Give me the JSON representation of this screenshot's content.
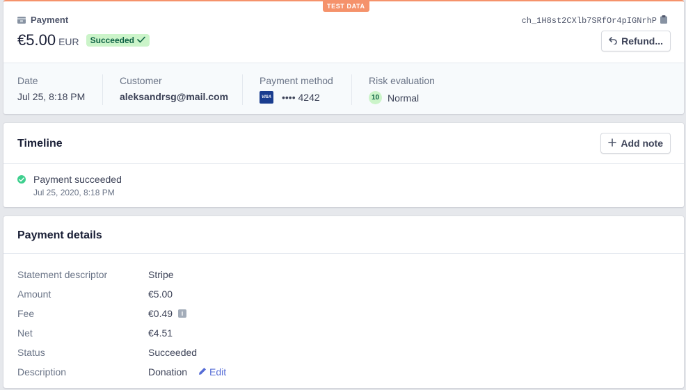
{
  "header": {
    "test_badge": "TEST DATA",
    "object_label": "Payment",
    "charge_id": "ch_1H8st2CXlb7SRfOr4pIGNrhP",
    "amount": "€5.00",
    "currency": "EUR",
    "status": "Succeeded",
    "refund_label": "Refund..."
  },
  "summary": {
    "date_label": "Date",
    "date_value": "Jul 25, 8:18 PM",
    "customer_label": "Customer",
    "customer_value": "aleksandrsg@mail.com",
    "method_label": "Payment method",
    "card_brand": "VISA",
    "method_value": "•••• 4242",
    "risk_label": "Risk evaluation",
    "risk_score": "10",
    "risk_value": "Normal"
  },
  "timeline": {
    "title": "Timeline",
    "add_note_label": "Add note",
    "events": [
      {
        "title": "Payment succeeded",
        "time": "Jul 25, 2020, 8:18 PM"
      }
    ]
  },
  "details": {
    "title": "Payment details",
    "rows": [
      {
        "label": "Statement descriptor",
        "value": "Stripe"
      },
      {
        "label": "Amount",
        "value": "€5.00"
      },
      {
        "label": "Fee",
        "value": "€0.49"
      },
      {
        "label": "Net",
        "value": "€4.51"
      },
      {
        "label": "Status",
        "value": "Succeeded"
      },
      {
        "label": "Description",
        "value": "Donation"
      }
    ],
    "edit_label": "Edit"
  },
  "colors": {
    "accent_test": "#f5926b",
    "success_bg": "#cbf4c9",
    "success_text": "#0e6245",
    "link": "#556cd6"
  }
}
